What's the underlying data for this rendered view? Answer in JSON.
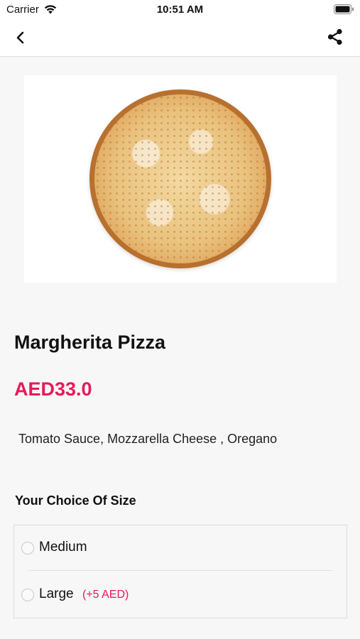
{
  "status_bar": {
    "carrier": "Carrier",
    "time": "10:51 AM",
    "icons": [
      "wifi-icon",
      "battery-icon"
    ]
  },
  "nav": {
    "icons": [
      "chevron-left-icon",
      "share-icon"
    ]
  },
  "product": {
    "image": "margherita-pizza-image",
    "title": "Margherita Pizza",
    "price": "AED33.0",
    "description": "Tomato Sauce, Mozzarella Cheese , Oregano"
  },
  "size_section": {
    "title": "Your Choice Of Size",
    "options": [
      {
        "label": "Medium",
        "extra": "",
        "selected": false
      },
      {
        "label": "Large",
        "extra": "(+5 AED)",
        "selected": false
      }
    ]
  },
  "colors": {
    "accent": "#e8195a",
    "background": "#f7f7f7",
    "card": "#ffffff"
  }
}
